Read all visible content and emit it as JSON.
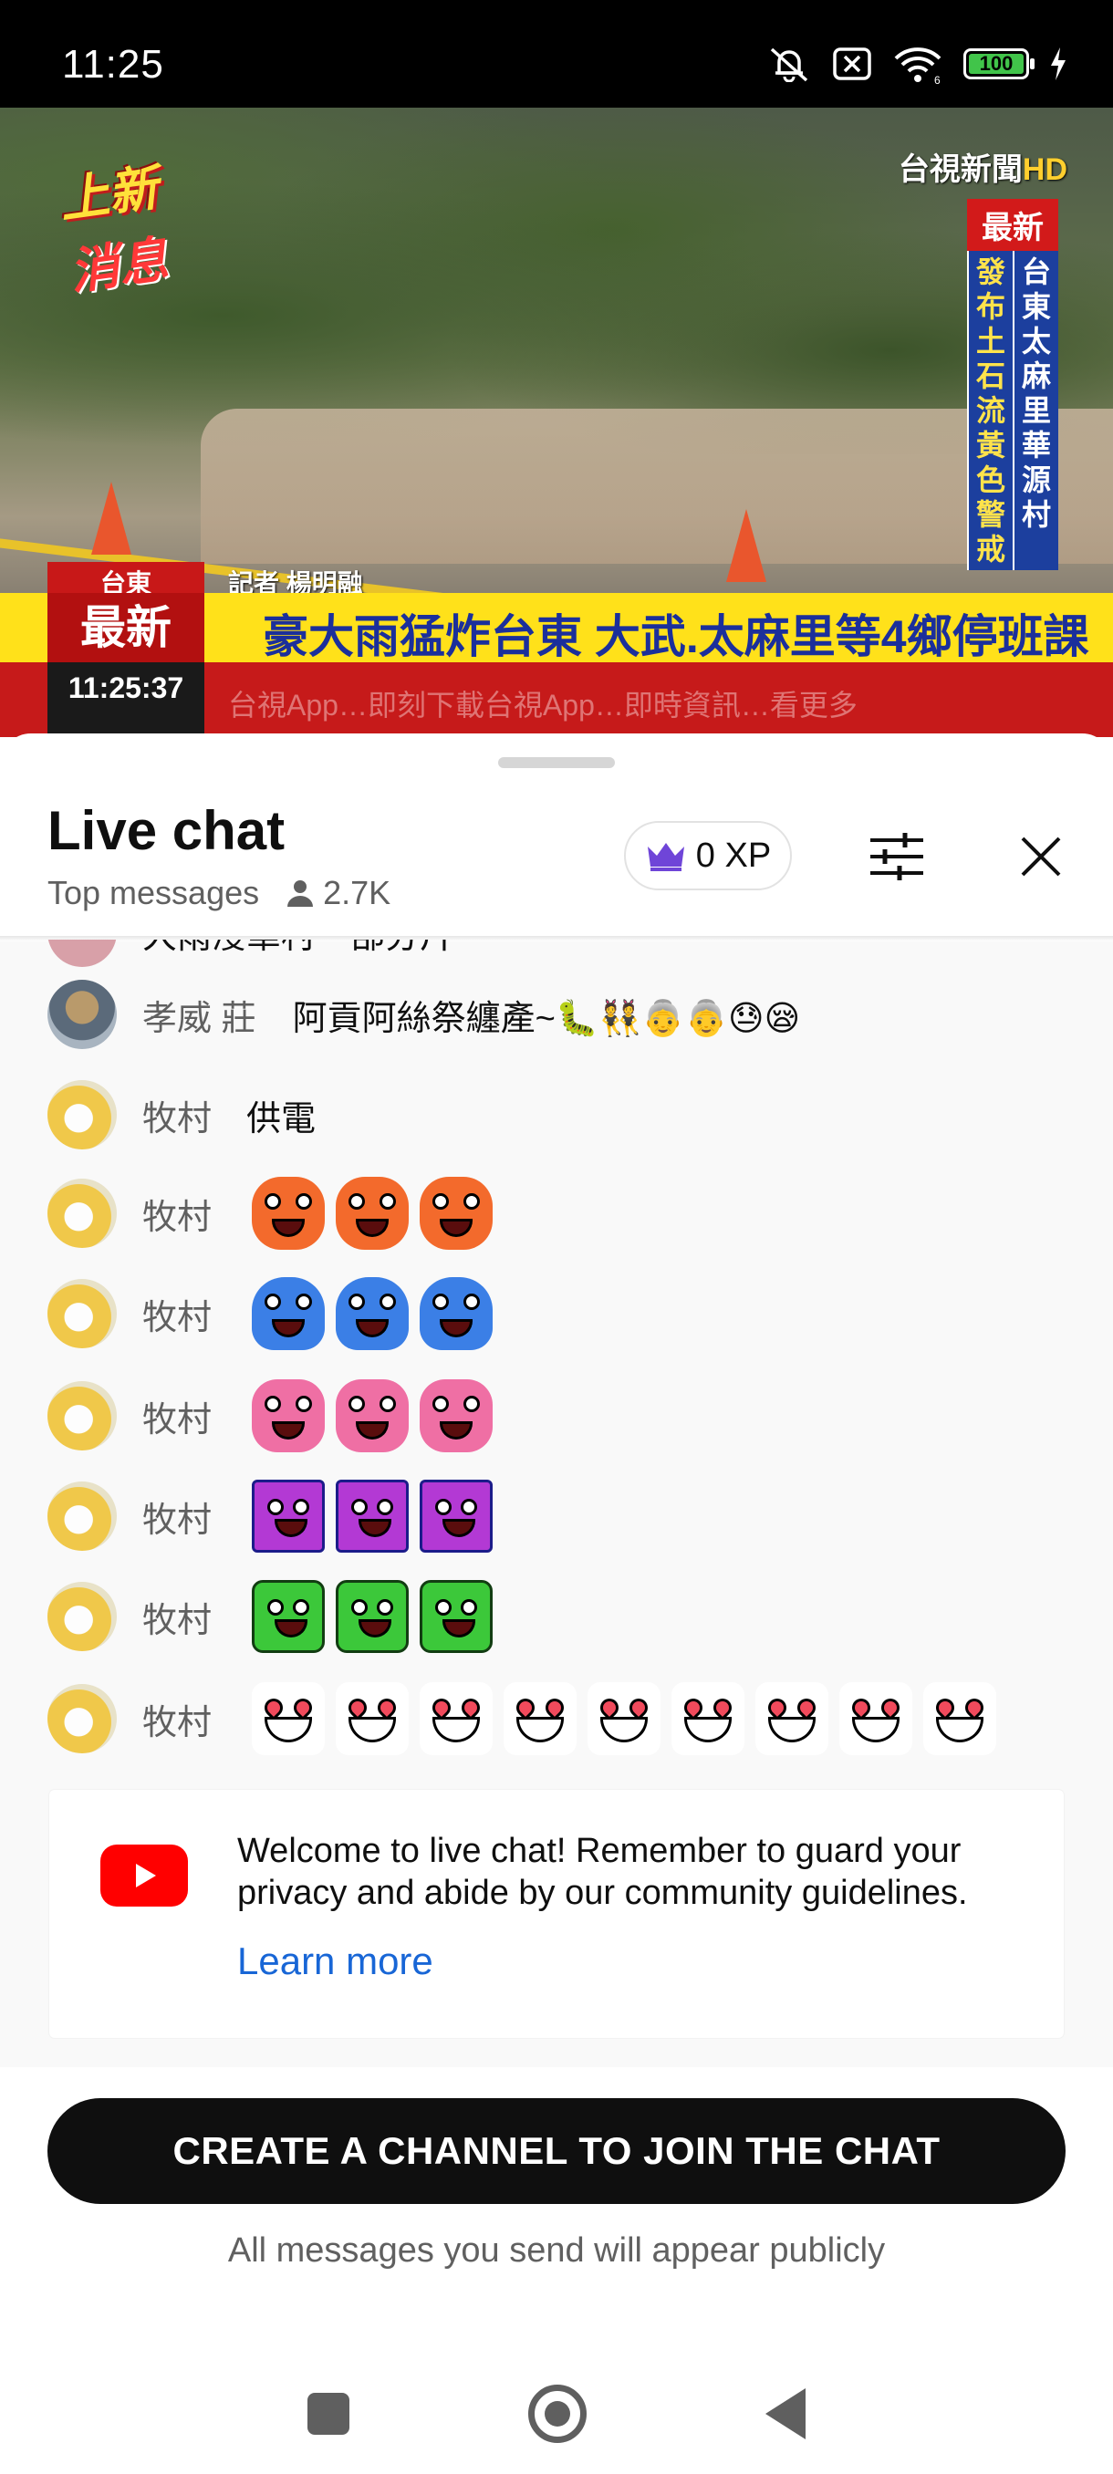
{
  "status_bar": {
    "time": "11:25",
    "battery": "100",
    "icons": [
      "mute-icon",
      "notification-block-icon",
      "wifi-icon",
      "battery-icon",
      "charging-icon"
    ]
  },
  "video": {
    "corner_logo_top": "上新",
    "corner_logo_bottom": "消息",
    "channel": "台視新聞",
    "channel_hd": "HD",
    "vertical_label": "最新",
    "vertical_col1": "台東太麻里華源村",
    "vertical_col2": "發布土石流黃色警戒",
    "region": "台東",
    "reporter": "記者 楊明融",
    "latest_box": "最新",
    "headline": "豪大雨猛炸台東 大武.太麻里等4鄉停班課",
    "clock": "11:25:37",
    "ticker": "台視App…即刻下載台視App…即時資訊…看更多"
  },
  "chat": {
    "title": "Live chat",
    "mode": "Top messages",
    "viewers": "2.7K",
    "xp": "0 XP",
    "partial_top_text": "大雨浸華村一部分片",
    "messages": [
      {
        "author": "孝威 莊",
        "text": "阿貢阿絲祭纏產~🐛👯👵👵😓😪",
        "avatar": "photo"
      },
      {
        "author": "牧村",
        "text": "供電",
        "avatar": "bird"
      },
      {
        "author": "牧村",
        "emotes": [
          "orange",
          "orange",
          "orange"
        ],
        "avatar": "bird"
      },
      {
        "author": "牧村",
        "emotes": [
          "blue",
          "blue",
          "blue"
        ],
        "avatar": "bird"
      },
      {
        "author": "牧村",
        "emotes": [
          "pink",
          "pink",
          "pink"
        ],
        "avatar": "bird"
      },
      {
        "author": "牧村",
        "emotes": [
          "purple",
          "purple",
          "purple"
        ],
        "avatar": "bird"
      },
      {
        "author": "牧村",
        "emotes": [
          "green",
          "green",
          "green"
        ],
        "avatar": "bird"
      },
      {
        "author": "牧村",
        "emotes": [
          "heart",
          "heart",
          "heart",
          "heart",
          "heart",
          "heart",
          "heart",
          "heart",
          "heart"
        ],
        "avatar": "bird"
      }
    ],
    "welcome": {
      "text": "Welcome to live chat! Remember to guard your privacy and abide by our community guidelines.",
      "link": "Learn more"
    },
    "cta": "CREATE A CHANNEL TO JOIN THE CHAT",
    "public_note": "All messages you send will appear publicly"
  },
  "colors": {
    "accent_link": "#1866d6",
    "youtube_red": "#ff0000",
    "headline_yellow": "#ffe11a",
    "headline_blue": "#1b2f9b"
  }
}
